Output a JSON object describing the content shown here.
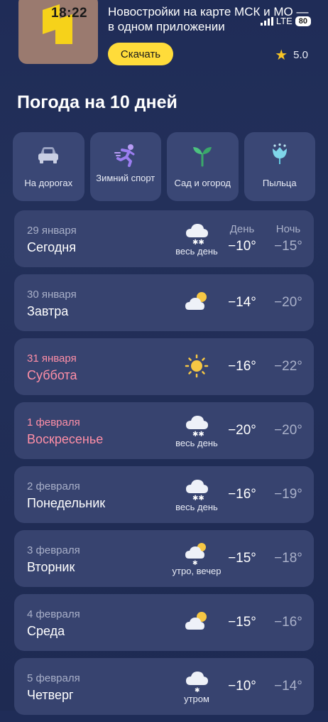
{
  "status": {
    "time": "18:22",
    "network": "LTE",
    "battery": "80"
  },
  "ad": {
    "text": "Новостройки на карте МСК и МО — в одном приложении",
    "button": "Скачать",
    "rating": "5.0"
  },
  "page": {
    "title": "Погода на 10 дней"
  },
  "tiles": [
    {
      "label": "На дорогах",
      "icon": "car-icon"
    },
    {
      "label": "Зимний спорт",
      "icon": "runner-icon"
    },
    {
      "label": "Сад и огород",
      "icon": "sprout-icon"
    },
    {
      "label": "Пыльца",
      "icon": "flower-icon"
    }
  ],
  "forecast": {
    "day_header": "День",
    "night_header": "Ночь",
    "days": [
      {
        "date": "29 января",
        "name": "Сегодня",
        "icon": "snow-cloud-icon",
        "note": "весь день",
        "day": "−10°",
        "night": "−15°",
        "weekend": false
      },
      {
        "date": "30 января",
        "name": "Завтра",
        "icon": "partly-cloudy-icon",
        "note": "",
        "day": "−14°",
        "night": "−20°",
        "weekend": false
      },
      {
        "date": "31 января",
        "name": "Суббота",
        "icon": "sun-icon",
        "note": "",
        "day": "−16°",
        "night": "−22°",
        "weekend": true
      },
      {
        "date": "1 февраля",
        "name": "Воскресенье",
        "icon": "snow-cloud-icon",
        "note": "весь день",
        "day": "−20°",
        "night": "−20°",
        "weekend": true
      },
      {
        "date": "2 февраля",
        "name": "Понедельник",
        "icon": "snow-cloud-icon",
        "note": "весь день",
        "day": "−16°",
        "night": "−19°",
        "weekend": false
      },
      {
        "date": "3 февраля",
        "name": "Вторник",
        "icon": "sun-snow-cloud-icon",
        "note": "утро, вечер",
        "day": "−15°",
        "night": "−18°",
        "weekend": false
      },
      {
        "date": "4 февраля",
        "name": "Среда",
        "icon": "partly-cloudy-icon",
        "note": "",
        "day": "−15°",
        "night": "−16°",
        "weekend": false
      },
      {
        "date": "5 февраля",
        "name": "Четверг",
        "icon": "light-snow-cloud-icon",
        "note": "утром",
        "day": "−10°",
        "night": "−14°",
        "weekend": false
      }
    ]
  }
}
